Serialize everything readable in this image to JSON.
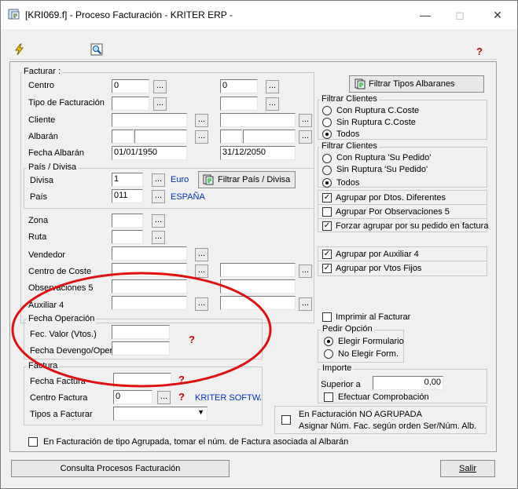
{
  "window": {
    "title": "[KRI069.f] - Proceso Facturación - KRITER ERP -"
  },
  "icons": {
    "flash": "lightning-icon",
    "zoom": "zoom-icon",
    "help": "help-icon"
  },
  "facturar": {
    "group_label": "Facturar :",
    "centro": {
      "label": "Centro",
      "from": "0",
      "to": "0"
    },
    "tipo": {
      "label": "Tipo de Facturación"
    },
    "cliente": {
      "label": "Cliente"
    },
    "albaran": {
      "label": "Albarán"
    },
    "fecha": {
      "label": "Fecha Albarán",
      "from": "01/01/1950",
      "to": "31/12/2050"
    },
    "filtrar_tipos": "Filtrar Tipos Albaranes"
  },
  "pais_divisa": {
    "group_label": "País / Divisa",
    "divisa": {
      "label": "Divisa",
      "value": "1",
      "desc": "Euro"
    },
    "pais": {
      "label": "País",
      "value": "011",
      "desc": "ESPAÑA"
    },
    "filtrar": "Filtrar País / Divisa"
  },
  "otros": {
    "zona": "Zona",
    "ruta": "Ruta",
    "vendedor": "Vendedor",
    "centro_coste": "Centro de Coste",
    "obs5": "Observaciones 5",
    "aux4": "Auxiliar 4"
  },
  "fecha_op": {
    "group_label": "Fecha Operación",
    "valor": "Fec. Valor (Vtos.)",
    "devengo": "Fecha Devengo/Oper"
  },
  "factura": {
    "group_label": "Factura",
    "fecha": "Fecha Factura",
    "centro": {
      "label": "Centro Factura",
      "value": "0",
      "desc": "KRITER SOFTWA"
    },
    "tipos": "Tipos a Facturar"
  },
  "filtrar_clientes_1": {
    "group_label": "Filtrar Clientes",
    "options": [
      "Con Ruptura C.Coste",
      "Sin Ruptura C.Coste",
      "Todos"
    ],
    "selected": 2
  },
  "filtrar_clientes_2": {
    "group_label": "Filtrar Clientes",
    "options": [
      "Con Ruptura 'Su Pedido'",
      "Sin Ruptura 'Su Pedido'",
      "Todos"
    ],
    "selected": 2
  },
  "checks": {
    "agrupar_dtos": {
      "label": "Agrupar por Dtos. Diferentes",
      "checked": true
    },
    "agrupar_obs5": {
      "label": "Agrupar Por Observaciones 5",
      "checked": false
    },
    "forzar": {
      "label": "Forzar agrupar por su pedido en factura",
      "checked": true
    },
    "agrupar_aux4": {
      "label": "Agrupar por Auxiliar 4",
      "checked": true
    },
    "agrupar_vtos": {
      "label": "Agrupar por Vtos Fijos",
      "checked": true
    },
    "imprimir": {
      "label": "Imprimir al Facturar",
      "checked": false
    }
  },
  "pedir_opcion": {
    "group_label": "Pedir Opción",
    "options": [
      "Elegir Formulario",
      "No Elegir Form."
    ],
    "selected": 0
  },
  "importe": {
    "group_label": "Importe",
    "superior_label": "Superior a",
    "superior_value": "0,00",
    "efectuar": "Efectuar Comprobación"
  },
  "no_agrupada": {
    "line1": "En Facturación NO AGRUPADA",
    "line2": "Asignar Núm. Fac. según orden Ser/Núm. Alb."
  },
  "agrupada_note": "En Facturación de tipo Agrupada, tomar el núm. de Factura asociada al Albarán",
  "footer": {
    "consulta": "Consulta Procesos Facturación",
    "salir": "Salir"
  }
}
